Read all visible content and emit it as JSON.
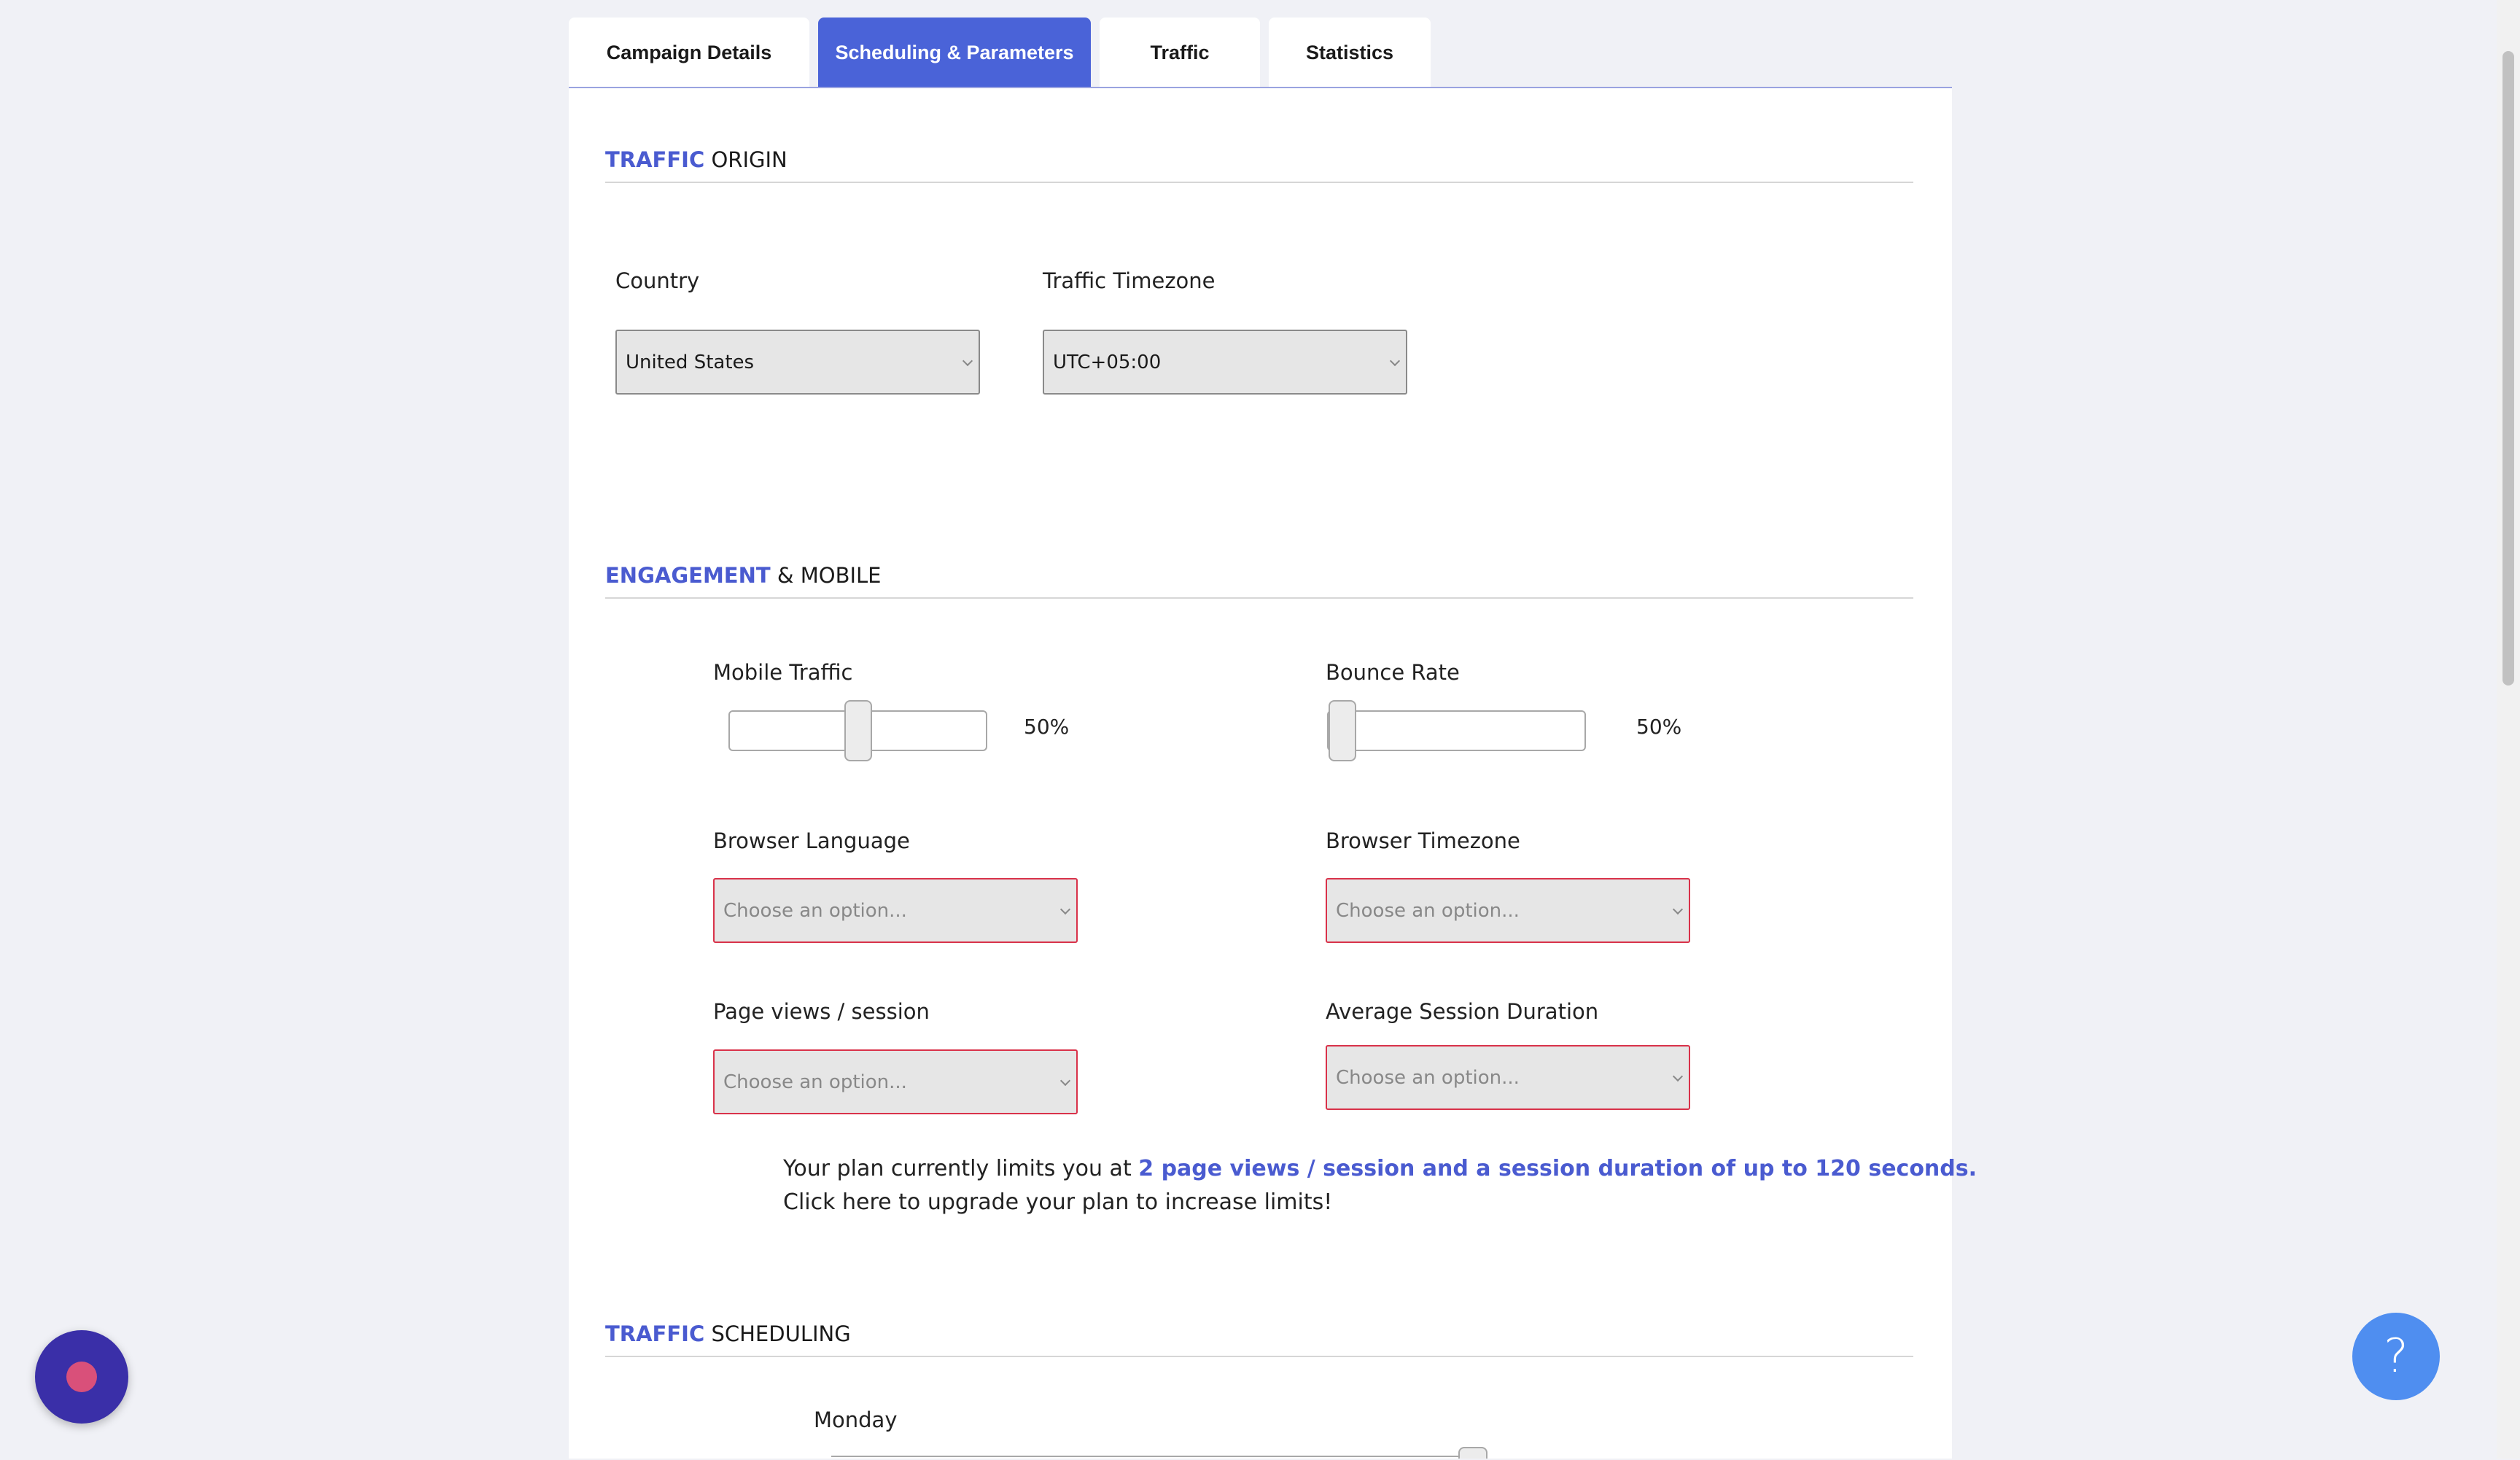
{
  "tabs": [
    {
      "label": "Campaign Details",
      "active": false
    },
    {
      "label": "Scheduling & Parameters",
      "active": true
    },
    {
      "label": "Traffic",
      "active": false
    },
    {
      "label": "Statistics",
      "active": false
    }
  ],
  "colors": {
    "accent": "#4a5bd0",
    "active_tab": "#4a63d8",
    "invalid_border": "#d9324a",
    "help_button": "#4f8ef0",
    "chat_bubble": "#3a2fa8"
  },
  "sections": {
    "origin": {
      "accent": "TRAFFIC",
      "rest": "ORIGIN"
    },
    "engagement": {
      "accent": "ENGAGEMENT",
      "rest": "& MOBILE"
    },
    "scheduling": {
      "accent": "TRAFFIC",
      "rest": "SCHEDULING"
    }
  },
  "origin": {
    "country_label": "Country",
    "country_value": "United States",
    "timezone_label": "Traffic Timezone",
    "timezone_value": "UTC+05:00"
  },
  "engagement": {
    "mobile_label": "Mobile Traffic",
    "mobile_value": "50%",
    "mobile_fraction": 0.5,
    "bounce_label": "Bounce Rate",
    "bounce_value": "50%",
    "bounce_fraction": 0.0,
    "browser_language_label": "Browser Language",
    "browser_language_placeholder": "Choose an option...",
    "browser_timezone_label": "Browser Timezone",
    "browser_timezone_placeholder": "Choose an option...",
    "pageviews_label": "Page views / session",
    "pageviews_placeholder": "Choose an option...",
    "session_duration_label": "Average Session Duration",
    "session_duration_placeholder": "Choose an option..."
  },
  "note": {
    "prefix": "Your plan currently limits you at",
    "highlight": "2 page views / session and a session duration of up to 120 seconds.",
    "upgrade": "Click here to upgrade your plan to increase limits!"
  },
  "scheduling": {
    "day_label": "Monday"
  },
  "help": {
    "icon_text": "?"
  },
  "icons": {
    "chat": "chat-bubble-icon",
    "help": "help-icon",
    "chevron": "chevron-down-icon"
  }
}
